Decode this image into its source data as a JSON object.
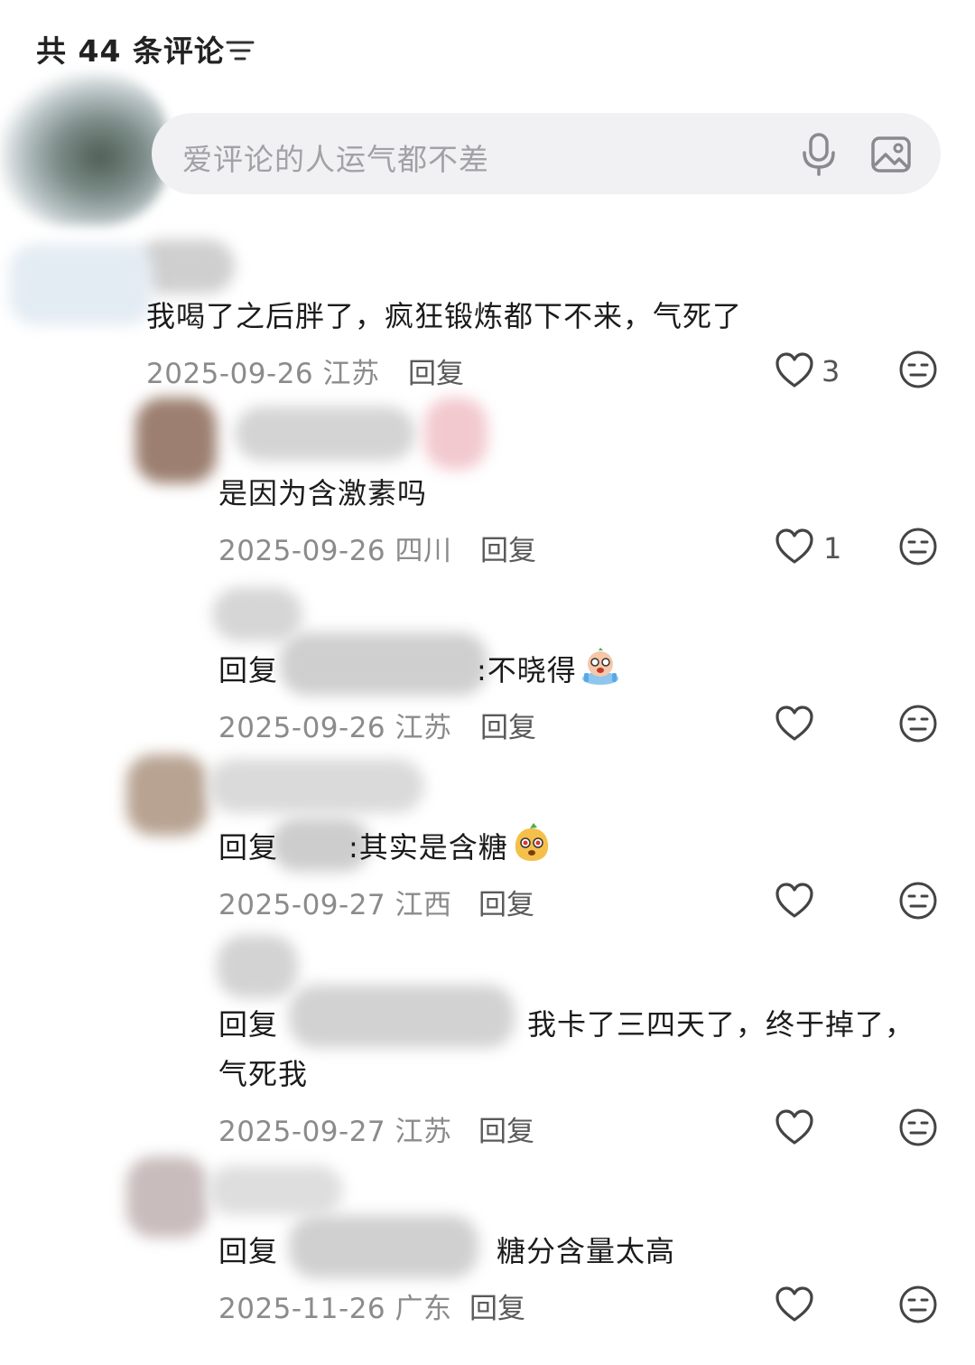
{
  "header": {
    "title": "共 44 条评论",
    "sort_icon": "sort-lines-icon"
  },
  "composer": {
    "placeholder": "爱评论的人运气都不差",
    "mic_icon": "microphone-icon",
    "image_icon": "image-icon"
  },
  "comments": [
    {
      "text": "我喝了之后胖了，疯狂锻炼都下不来，气死了",
      "date": "2025-09-26",
      "region": "江苏",
      "reply": "回复",
      "likes": "3"
    },
    {
      "text": "是因为含激素吗",
      "date": "2025-09-26",
      "region": "四川",
      "reply": "回复",
      "likes": "1"
    },
    {
      "reply_prefix": "回复",
      "text": ":不晓得",
      "emoji": "crying-emoji",
      "date": "2025-09-26",
      "region": "江苏",
      "reply": "回复",
      "likes": ""
    },
    {
      "reply_prefix": "回复",
      "text": ":其实是含糖",
      "emoji": "shocked-fruit-emoji",
      "date": "2025-09-27",
      "region": "江西",
      "reply": "回复",
      "likes": ""
    },
    {
      "reply_prefix": "回复",
      "text": "我卡了三四天了，终于掉了，",
      "text_line2": "气死我",
      "date": "2025-09-27",
      "region": "江苏",
      "reply": "回复",
      "likes": ""
    },
    {
      "reply_prefix": "回复",
      "text": "糖分含量太高",
      "date": "2025-11-26",
      "region": "广东",
      "reply": "回复",
      "likes": ""
    }
  ],
  "icons": {
    "like": "heart-outline-icon",
    "dislike": "neutral-face-icon"
  },
  "colors": {
    "input_bg": "#f1f1f3",
    "meta_text": "#8b8b8b",
    "placeholder": "#a2a2a6"
  }
}
